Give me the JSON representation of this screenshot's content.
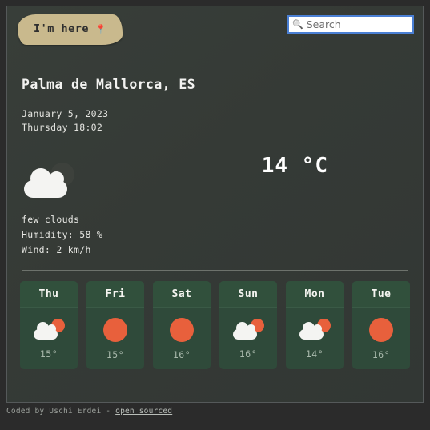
{
  "header": {
    "im_here_label": "I'm here",
    "im_here_icon": "map-pin-icon",
    "search_icon": "search-icon",
    "search_value": "",
    "search_placeholder": "Search"
  },
  "current": {
    "city": "Palma de Mallorca, ES",
    "date": "January 5, 2023",
    "time": "Thursday 18:02",
    "temperature": "14 °C",
    "condition": "few clouds",
    "humidity": "Humidity: 58 %",
    "wind": "Wind: 2 km/h",
    "icon": "few-clouds-night-icon"
  },
  "forecast": {
    "days": [
      {
        "day": "Thu",
        "temp": "15°",
        "icon": "few-clouds-day-icon"
      },
      {
        "day": "Fri",
        "temp": "15°",
        "icon": "clear-sky-icon"
      },
      {
        "day": "Sat",
        "temp": "16°",
        "icon": "clear-sky-icon"
      },
      {
        "day": "Sun",
        "temp": "16°",
        "icon": "few-clouds-day-icon"
      },
      {
        "day": "Mon",
        "temp": "14°",
        "icon": "few-clouds-day-icon"
      },
      {
        "day": "Tue",
        "temp": "16°",
        "icon": "clear-sky-icon"
      }
    ]
  },
  "footer": {
    "credit": "Coded by Uschi Erdei - ",
    "link": "open sourced"
  },
  "colors": {
    "panel_bg": "#353a36",
    "page_bg": "#2b2b2b",
    "accent_button": "#c9b98d",
    "card_bg": "#2f4a3a",
    "sun_orange": "#e8603c",
    "search_focus": "#4a7fd4"
  }
}
